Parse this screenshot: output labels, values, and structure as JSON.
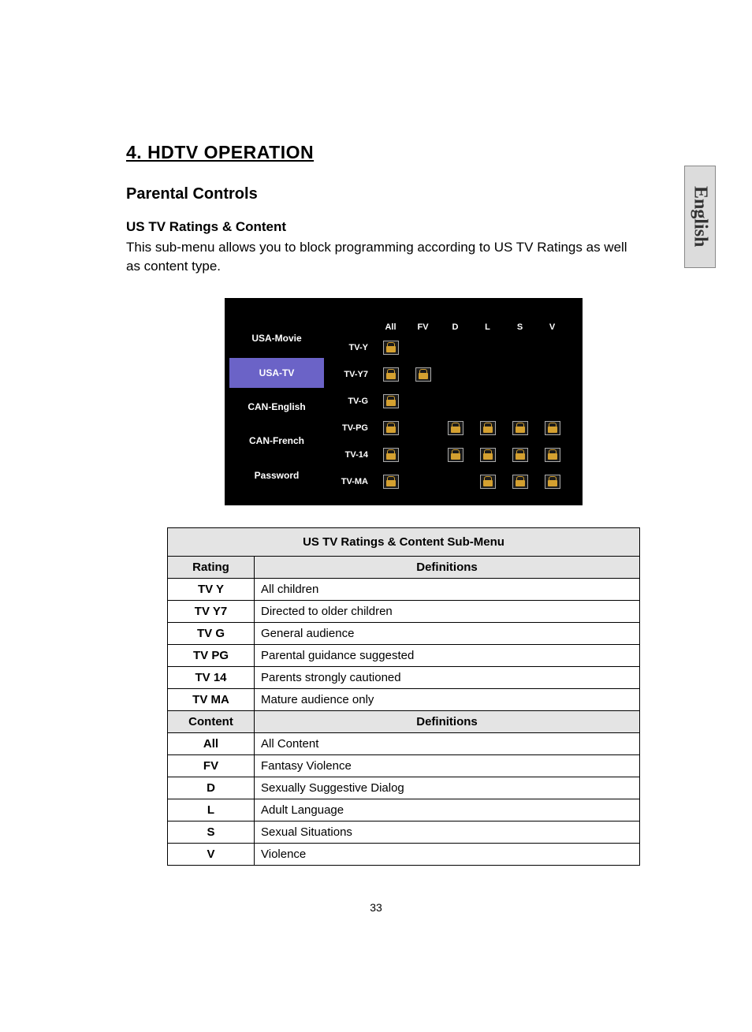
{
  "lang_tab": "English",
  "section_title": "4.    HDTV OPERATION",
  "subsection": "Parental Controls",
  "heading": "US TV Ratings & Content",
  "intro": "This sub-menu allows you to block programming according to US TV Ratings as well as content type.",
  "page_number": "33",
  "screenshot": {
    "side_menu": [
      "USA-Movie",
      "USA-TV",
      "CAN-English",
      "CAN-French",
      "Password"
    ],
    "active_index": 1,
    "columns": [
      "All",
      "FV",
      "D",
      "L",
      "S",
      "V"
    ],
    "rows": [
      {
        "label": "TV-Y",
        "locks": [
          true,
          false,
          false,
          false,
          false,
          false
        ]
      },
      {
        "label": "TV-Y7",
        "locks": [
          true,
          true,
          false,
          false,
          false,
          false
        ]
      },
      {
        "label": "TV-G",
        "locks": [
          true,
          false,
          false,
          false,
          false,
          false
        ]
      },
      {
        "label": "TV-PG",
        "locks": [
          true,
          false,
          true,
          true,
          true,
          true
        ]
      },
      {
        "label": "TV-14",
        "locks": [
          true,
          false,
          true,
          true,
          true,
          true
        ]
      },
      {
        "label": "TV-MA",
        "locks": [
          true,
          false,
          false,
          true,
          true,
          true
        ]
      }
    ]
  },
  "def_table": {
    "title": "US TV Ratings & Content Sub-Menu",
    "rating_header": {
      "col1": "Rating",
      "col2": "Definitions"
    },
    "ratings": [
      {
        "code": "TV Y",
        "def": "All children"
      },
      {
        "code": "TV Y7",
        "def": "Directed to older children"
      },
      {
        "code": "TV G",
        "def": "General audience"
      },
      {
        "code": "TV PG",
        "def": "Parental guidance suggested"
      },
      {
        "code": "TV 14",
        "def": "Parents strongly cautioned"
      },
      {
        "code": "TV MA",
        "def": "Mature audience only"
      }
    ],
    "content_header": {
      "col1": "Content",
      "col2": "Definitions"
    },
    "contents": [
      {
        "code": "All",
        "def": "All Content"
      },
      {
        "code": "FV",
        "def": "Fantasy Violence"
      },
      {
        "code": "D",
        "def": "Sexually Suggestive Dialog"
      },
      {
        "code": "L",
        "def": "Adult Language"
      },
      {
        "code": "S",
        "def": "Sexual Situations"
      },
      {
        "code": "V",
        "def": "Violence"
      }
    ]
  }
}
